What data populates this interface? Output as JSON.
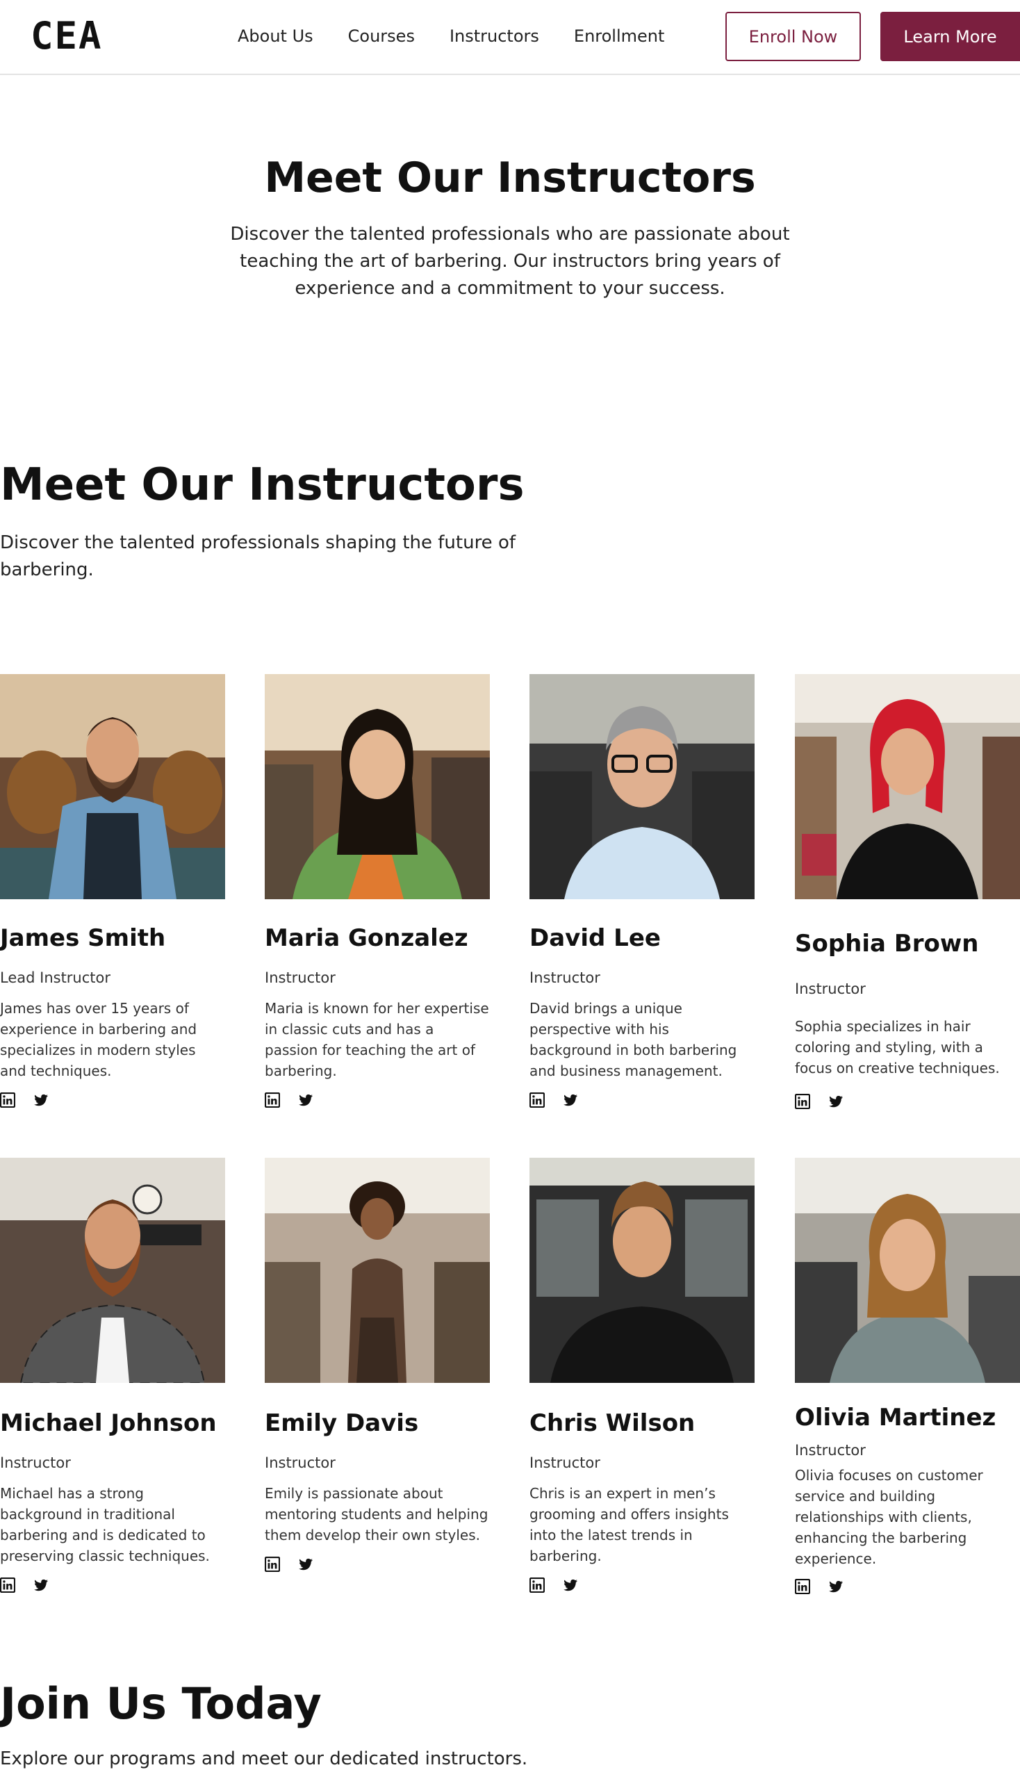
{
  "header": {
    "logo_text": "CEA",
    "nav": [
      "About Us",
      "Courses",
      "Instructors",
      "Enrollment"
    ],
    "enroll_label": "Enroll Now",
    "learn_label": "Learn More"
  },
  "hero": {
    "title": "Meet Our Instructors",
    "description": "Discover the talented professionals who are passionate about teaching the art of barbering. Our instructors bring years of experience and a commitment to your success."
  },
  "section": {
    "title": "Meet Our Instructors",
    "description": "Discover the talented professionals shaping the future of barbering."
  },
  "instructors": [
    {
      "name": "James Smith",
      "role": "Lead Instructor",
      "bio": "James has over 15 years of experience in barbering and specializes in modern styles and techniques."
    },
    {
      "name": "Maria Gonzalez",
      "role": "Instructor",
      "bio": "Maria is known for her expertise in classic cuts and has a passion for teaching the art of barbering."
    },
    {
      "name": "David Lee",
      "role": "Instructor",
      "bio": "David brings a unique perspective with his background in both barbering and business management."
    },
    {
      "name": "Sophia Brown",
      "role": "Instructor",
      "bio": "Sophia specializes in hair coloring and styling, with a focus on creative techniques."
    },
    {
      "name": "Michael Johnson",
      "role": "Instructor",
      "bio": "Michael has a strong background in traditional barbering and is dedicated to preserving classic techniques."
    },
    {
      "name": "Emily Davis",
      "role": "Instructor",
      "bio": "Emily is passionate about mentoring students and helping them develop their own styles."
    },
    {
      "name": "Chris Wilson",
      "role": "Instructor",
      "bio": "Chris is an expert in men’s grooming and offers insights into the latest trends in barbering."
    },
    {
      "name": "Olivia Martinez",
      "role": "Instructor",
      "bio": "Olivia focuses on customer service and building relationships with clients, enhancing the barbering experience."
    }
  ],
  "join": {
    "title": "Join Us Today",
    "description": "Explore our programs and meet our dedicated instructors."
  },
  "colors": {
    "accent": "#7b1f3f"
  },
  "icons": [
    "linkedin-icon",
    "twitter-icon"
  ]
}
